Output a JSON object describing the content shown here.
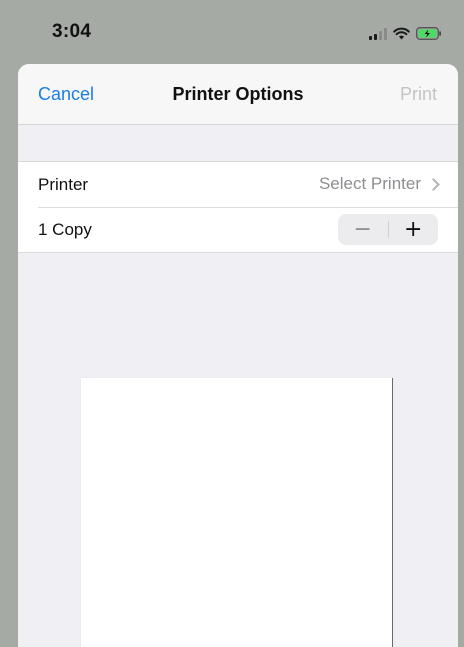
{
  "status_bar": {
    "time": "3:04",
    "icons": [
      "cellular-signal-icon",
      "wifi-icon",
      "battery-charging-icon"
    ],
    "battery_color": "#4cd964"
  },
  "nav": {
    "cancel_label": "Cancel",
    "title": "Printer Options",
    "print_label": "Print"
  },
  "options": {
    "printer_label": "Printer",
    "printer_value": "Select Printer",
    "copies_label": "1 Copy",
    "decrement_symbol": "−",
    "increment_symbol": "+"
  },
  "colors": {
    "accent": "#1a7ee6",
    "disabled_text": "#c4c4c6",
    "secondary_text": "#8e8e93",
    "sheet_background": "#efeff4",
    "dimmed_background": "#a5aaa5"
  }
}
